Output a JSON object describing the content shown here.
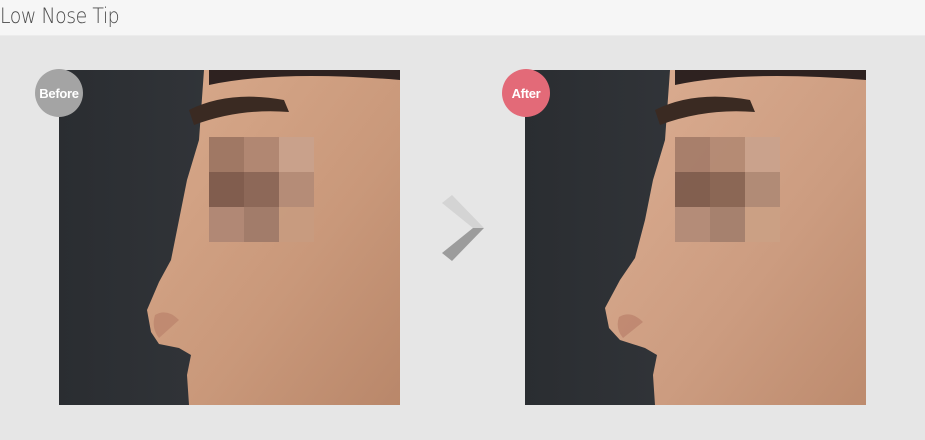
{
  "page": {
    "title": "Low Nose Tip"
  },
  "comparison": {
    "before_label": "Before",
    "after_label": "After"
  },
  "colors": {
    "before_badge": "#a4a4a4",
    "after_badge": "#e36a78",
    "background": "#e6e6e6"
  },
  "icons": {
    "divider": "chevron-right-icon"
  }
}
